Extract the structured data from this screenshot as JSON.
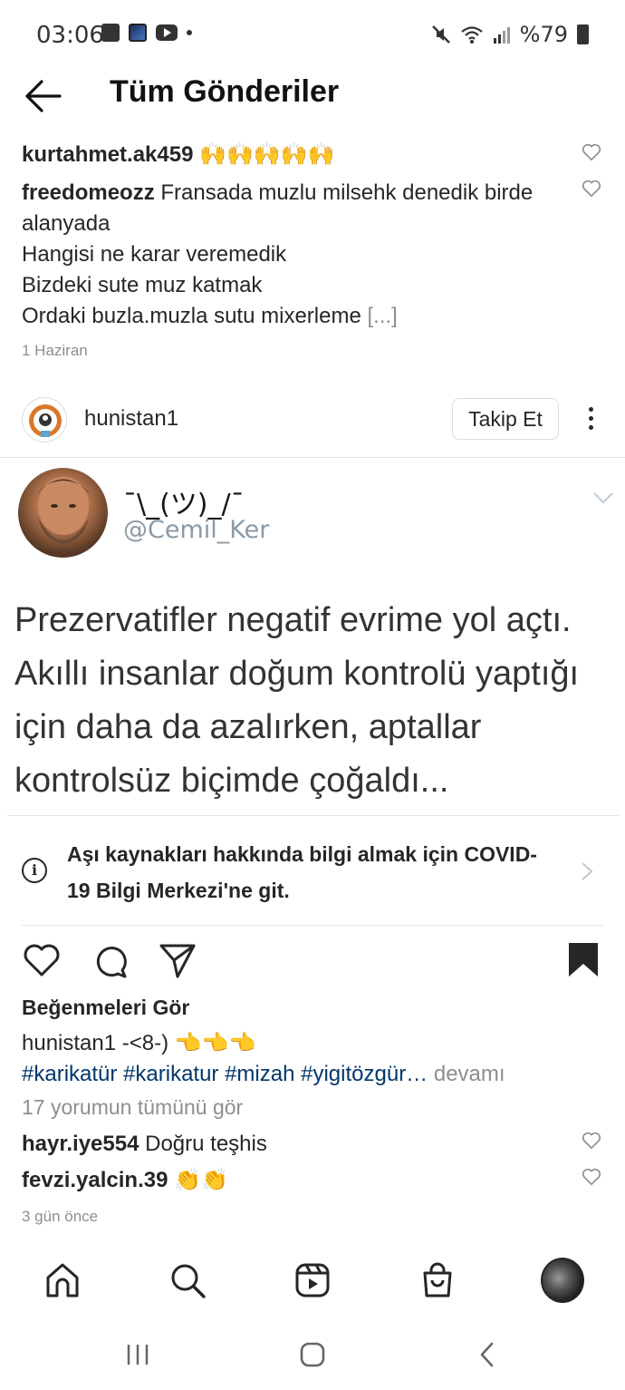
{
  "status_bar": {
    "time": "03:06",
    "battery": "%79",
    "icons": [
      "photo-icon",
      "space-icon",
      "youtube-icon",
      "dot-icon",
      "mute-icon",
      "wifi-icon",
      "signal-icon",
      "battery-icon"
    ]
  },
  "header": {
    "title": "Tüm Gönderiler"
  },
  "comments_top": [
    {
      "user": "kurtahmet.ak459",
      "text": "🙌🙌🙌🙌🙌"
    },
    {
      "user": "freedomeozz",
      "text": "Fransada muzlu milsehk denedik birde alanyada",
      "lines": [
        "Hangisi ne karar veremedik",
        "Bizdeki sute muz katmak",
        "Ordaki buzla.muzla sutu mixerleme"
      ],
      "more": "[...]"
    }
  ],
  "comments_top_time": "1 Haziran",
  "post": {
    "username": "hunistan1",
    "follow_label": "Takip Et"
  },
  "tweet": {
    "name": "¯\\_(ツ)_/¯",
    "handle": "@Cemil_Ker",
    "text": "Prezervatifler negatif evrime yol açtı. Akıllı insanlar doğum kontrolü yaptığı için daha da azalırken, aptallar kontrolsüz biçimde çoğaldı..."
  },
  "covid": {
    "text": "Aşı kaynakları hakkında bilgi almak için COVID-19 Bilgi Merkezi'ne git."
  },
  "likes_link": "Beğenmeleri Gör",
  "caption": {
    "user": "hunistan1",
    "text": "-<8-) 👈👈👈",
    "hashtags": "#karikatür #karikatur #mizah #yigitözgür…",
    "more": " devamı"
  },
  "all_comments": "17 yorumun tümünü gör",
  "comments_bottom": [
    {
      "user": "hayr.iye554",
      "text": "Doğru teşhis"
    },
    {
      "user": "fevzi.yalcin.39",
      "text": "👏👏"
    }
  ],
  "comments_bottom_time": "3 gün önce",
  "colors": {
    "text": "#262626",
    "secondary": "#8e8e8e",
    "hashtag": "#00376b",
    "tweet_handle": "#8a9aa6"
  }
}
